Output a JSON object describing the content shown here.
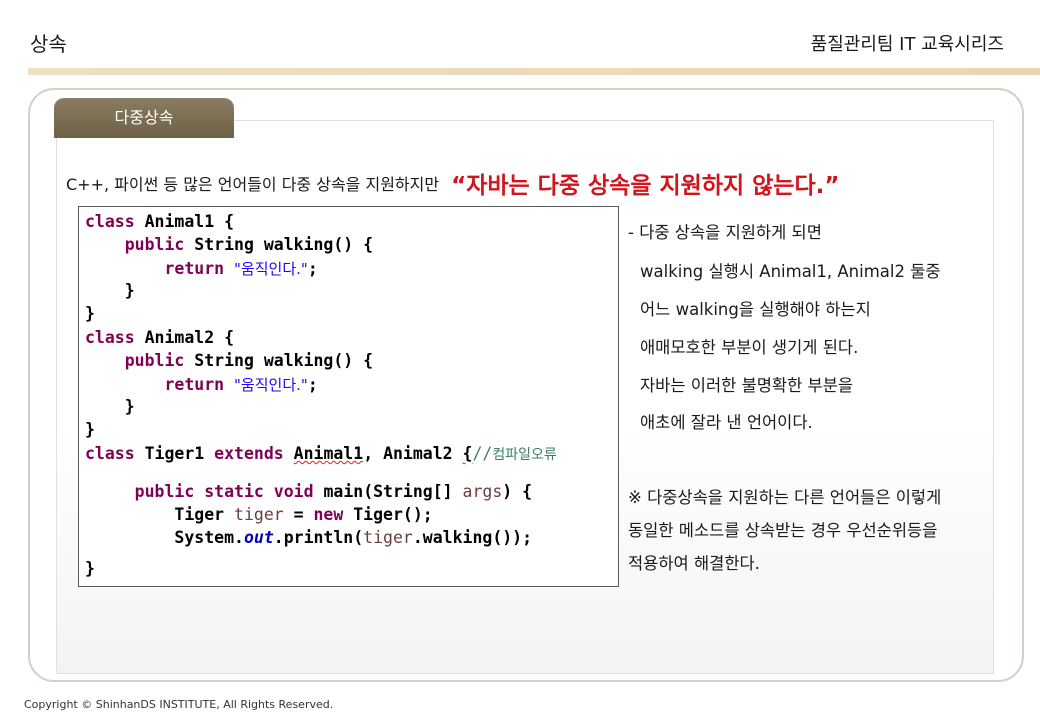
{
  "header": {
    "title": "상속",
    "series": "품질관리팀 IT 교육시리즈"
  },
  "section": {
    "tab_label": "다중상속"
  },
  "intro": {
    "plain": "C++, 파이썬 등 많은 언어들이 다중 상속을 지원하지만",
    "emphasis": "“자바는 다중 상속을 지원하지 않는다.”"
  },
  "code": {
    "kw_class": "class",
    "kw_public": "public",
    "kw_return": "return",
    "kw_extends": "extends",
    "kw_static": "static",
    "kw_void": "void",
    "kw_new": "new",
    "name_animal1": "Animal1",
    "name_animal2": "Animal2",
    "name_tiger1": "Tiger1",
    "brace_open": "{",
    "brace_close": "}",
    "method_decl": "String walking() {",
    "string_ko": "\"움직인다.\"",
    "semicolon": ";",
    "comma": ",",
    "comment_slashes": "//",
    "comment_ko": "컴파일오류",
    "main_decl": "main(String[]",
    "main_args": "args",
    "main_close": ") {",
    "tiger_type": "Tiger",
    "tiger_var": "tiger",
    "tiger_ctor": "Tiger();",
    "system_prefix": "System.",
    "system_out": "out",
    "println_open": ".println(",
    "walking_call": ".walking());",
    "equals": "="
  },
  "notes": {
    "lines": [
      "- 다중 상속을 지원하게 되면",
      "walking 실행시 Animal1, Animal2 둘중",
      "어느 walking을 실행해야 하는지",
      "애매모호한 부분이 생기게 된다.",
      "자바는 이러한 불명확한 부분을",
      "애초에 잘라 낸 언어이다."
    ],
    "extra_lines": [
      "※ 다중상속을 지원하는 다른 언어들은 이렇게",
      "동일한 메소드를 상속받는 경우 우선순위등을",
      "적용하여 해결한다."
    ]
  },
  "footer": {
    "copyright": "Copyright © ShinhanDS INSTITUTE, All Rights Reserved."
  }
}
